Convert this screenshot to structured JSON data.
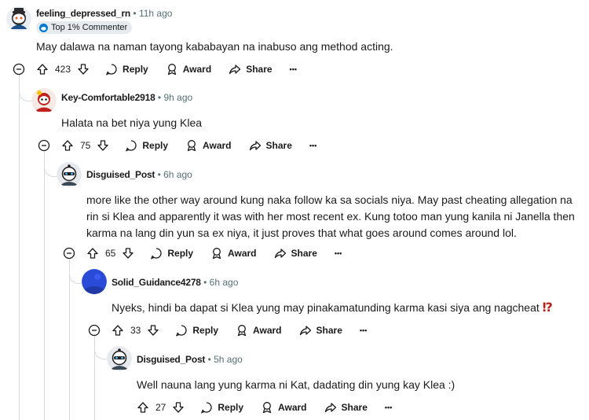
{
  "comments": [
    {
      "username": "feeling_depressed_rn",
      "sep": "•",
      "time": "11h ago",
      "flair": "Top 1% Commenter",
      "text": "May dalawa na naman tayong kababayan na inabuso ang method acting.",
      "score": "423"
    },
    {
      "username": "Key-Comfortable2918",
      "sep": "•",
      "time": "9h ago",
      "text": "Halata na bet niya yung Klea",
      "score": "75"
    },
    {
      "username": "Disguised_Post",
      "sep": "•",
      "time": "6h ago",
      "text_lines": [
        "more like the other way around kung naka follow ka sa socials niya. May past cheating allegation na",
        "rin si Klea and apparently it was with her most recent ex. Kung totoo man yung kanila ni Janella then",
        "karma na lang din yun sa ex niya, it just proves that what goes around comes around lol."
      ],
      "score": "65"
    },
    {
      "username": "Solid_Guidance4278",
      "sep": "•",
      "time": "6h ago",
      "text": "Nyeks, hindi ba dapat si Klea yung may pinakamatunding karma kasi siya ang nagcheat",
      "emoji": "⁉",
      "score": "33"
    },
    {
      "username": "Disguised_Post",
      "sep": "•",
      "time": "5h ago",
      "text": "Well nauna lang yung karma ni Kat, dadating din yung kay Klea :)",
      "score": "27"
    }
  ],
  "actions": {
    "reply": "Reply",
    "award": "Award",
    "share": "Share",
    "more": "•••"
  },
  "colors": {
    "thread_line": "#d7dadc",
    "meta_gray": "#576f76",
    "flair_bg": "#e5ebee",
    "emoji_red": "#b3261e"
  }
}
